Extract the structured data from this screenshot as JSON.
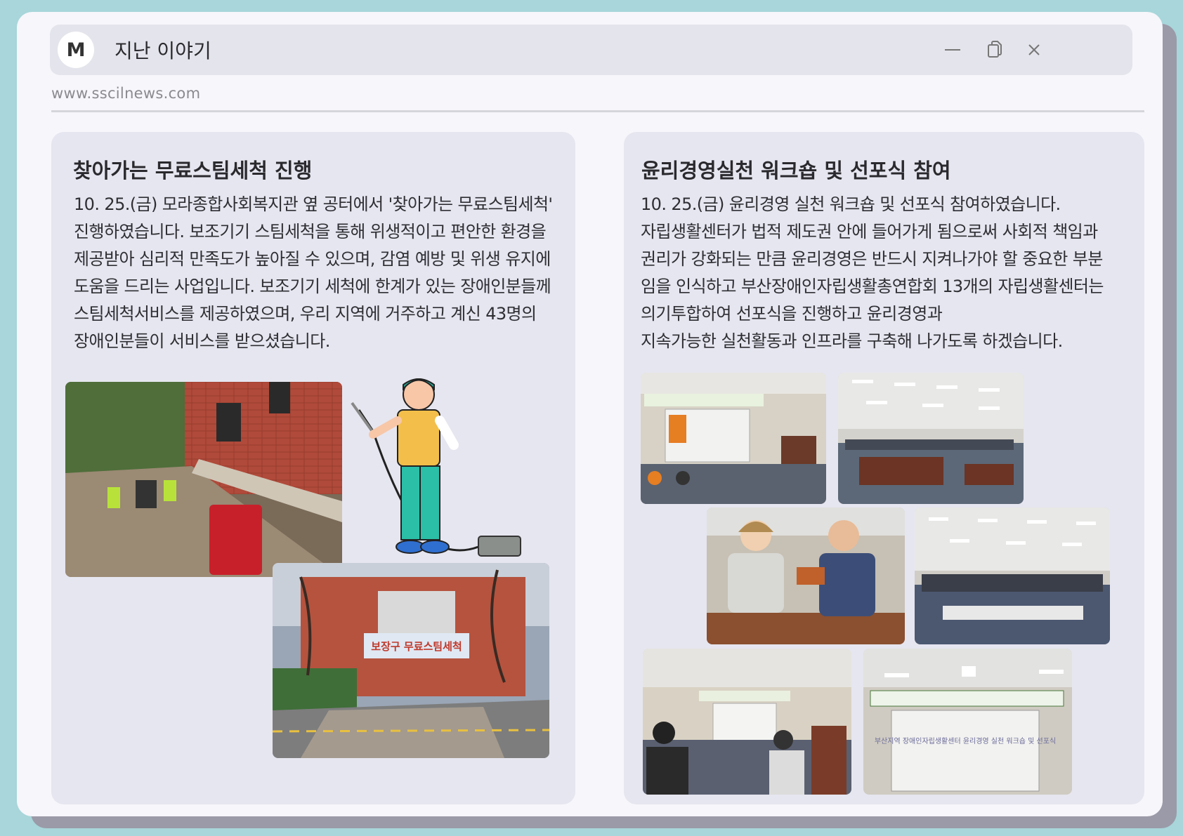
{
  "window": {
    "avatar_letter": "M",
    "title": "지난 이야기",
    "url": "www.sscilnews.com"
  },
  "left_card": {
    "heading": "찾아가는 무료스팀세척 진행",
    "lines": [
      "10. 25.(금) 모라종합사회복지관 옆 공터에서 '찾아가는 무료스팀세척'",
      "진행하였습니다. 보조기기 스팀세척을 통해 위생적이고 편안한 환경을",
      "제공받아 심리적 만족도가 높아질 수 있으며, 감염 예방 및 위생 유지에",
      "도움을 드리는 사업입니다. 보조기기 세척에 한계가 있는 장애인분들께",
      "스팀세척서비스를 제공하였으며, 우리 지역에 거주하고 계신 43명의",
      "장애인분들이 서비스를 받으셨습니다."
    ],
    "banner_text": "보장구 무료스팀세척"
  },
  "right_card": {
    "heading": "윤리경영실천 워크숍 및 선포식 참여",
    "lines": [
      "10. 25.(금) 윤리경영 실천 워크숍 및 선포식 참여하였습니다.",
      "자립생활센터가 법적 제도권 안에 들어가게 됨으로써 사회적 책임과",
      "권리가 강화되는 만큼 윤리경영은 반드시 지켜나가야 할 중요한 부분",
      "임을 인식하고 부산장애인자립생활총연합회 13개의 자립생활센터는",
      "의기투합하여 선포식을 진행하고 윤리경영과",
      "지속가능한 실천활동과 인프라를 구축해 나가도록 하겠습니다."
    ],
    "screen_text": "부산지역 장애인자립생활센터 윤리경영 실천 워크숍 및 선포식"
  }
}
